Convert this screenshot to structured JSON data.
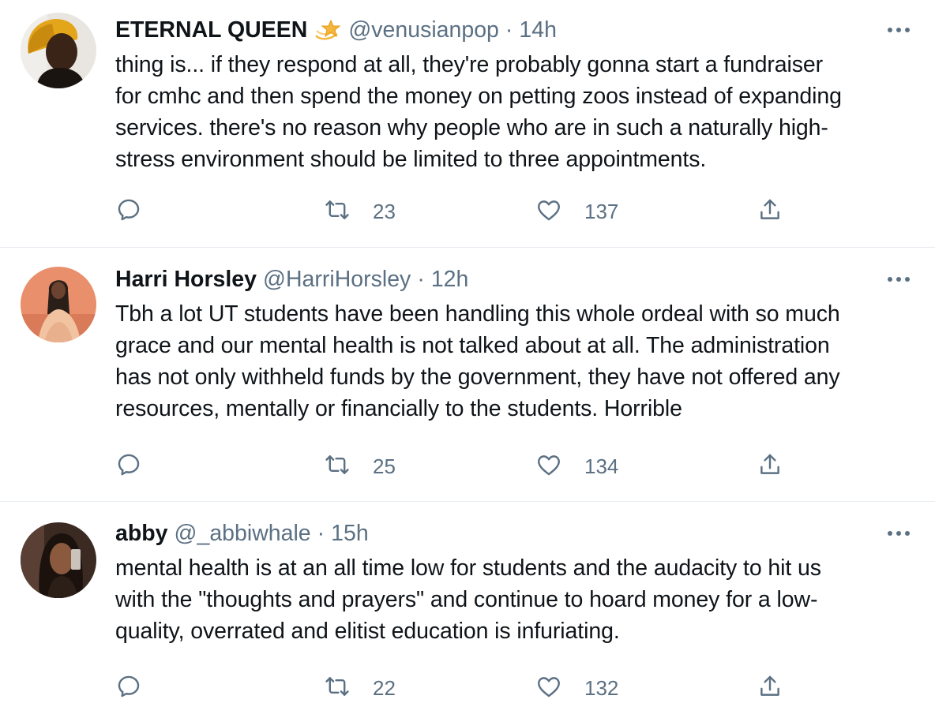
{
  "tweets": [
    {
      "name": "ETERNAL QUEEN",
      "badge": "dizzy-star-emoji",
      "handle": "@venusianpop",
      "separator": "·",
      "time": "14h",
      "text_lines": [
        "thing is... if they respond at all, they're probably gonna start a fundraiser",
        "for cmhc and then spend the money on petting zoos instead of expanding",
        "services. there's no reason why people who are in such a naturally high-",
        "stress environment should be limited to three appointments."
      ],
      "retweets": "23",
      "likes": "137"
    },
    {
      "name": "Harri Horsley",
      "handle": "@HarriHorsley",
      "separator": "·",
      "time": "12h",
      "text_lines": [
        "Tbh a lot UT students have been handling this whole ordeal with so much",
        "grace and our mental health is not talked about at all. The administration",
        "has not only withheld funds by the government, they have not offered any",
        "resources, mentally or financially to the students. Horrible"
      ],
      "retweets": "25",
      "likes": "134"
    },
    {
      "name": "abby",
      "handle": "@_abbiwhale",
      "separator": "·",
      "time": "15h",
      "text_lines": [
        "mental health is at an all time low for students and the audacity to hit us",
        "with the \"thoughts and prayers\" and continue to hoard money for a low-",
        "quality, overrated and elitist education is infuriating."
      ],
      "retweets": "22",
      "likes": "132"
    }
  ],
  "icons": {
    "reply": "reply-icon",
    "retweet": "retweet-icon",
    "like": "like-icon",
    "share": "share-icon",
    "more": "more-icon"
  },
  "colors": {
    "text": "#0f1419",
    "secondary": "#5b7083",
    "divider": "#e6ecf0",
    "background": "#ffffff"
  }
}
